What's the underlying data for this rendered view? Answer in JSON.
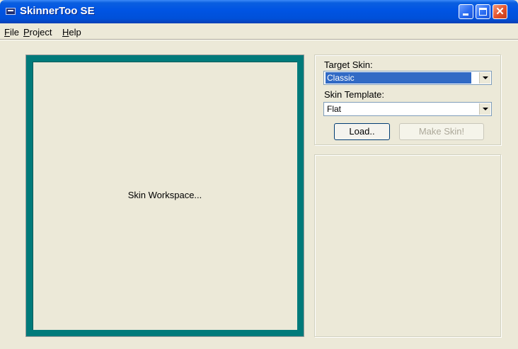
{
  "window": {
    "title": "SkinnerToo SE",
    "close_glyph": "✕"
  },
  "menu": [
    {
      "label": "File"
    },
    {
      "label": "Project"
    },
    {
      "label": "Help"
    }
  ],
  "workspace": {
    "label": "Skin Workspace..."
  },
  "panel": {
    "target_skin_label": "Target Skin:",
    "target_skin_value": "Classic",
    "skin_template_label": "Skin Template:",
    "skin_template_value": "Flat",
    "load_button": "Load..",
    "make_skin_button": "Make Skin!"
  },
  "colors": {
    "titlebar": "#0054e3",
    "workspace_border": "#007a7a",
    "selection": "#316ac5",
    "window_bg": "#ece9d8"
  }
}
